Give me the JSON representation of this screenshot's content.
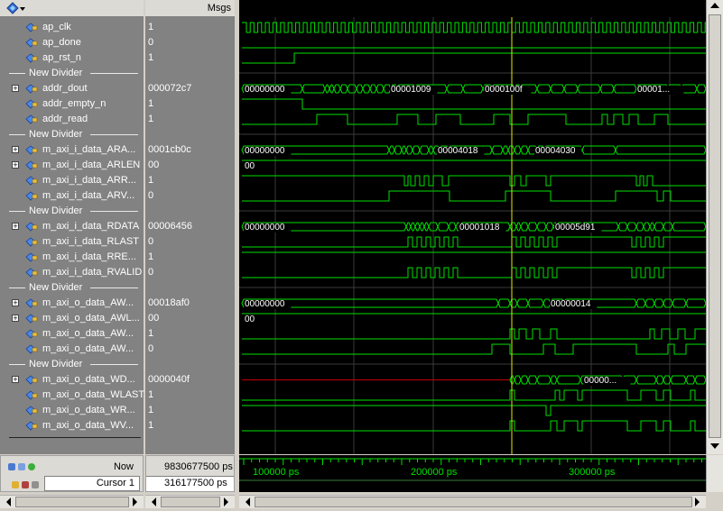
{
  "header": {
    "msgs_label": "Msgs"
  },
  "signals": [
    {
      "type": "sig",
      "name": "ap_clk",
      "value": "1"
    },
    {
      "type": "sig",
      "name": "ap_done",
      "value": "0"
    },
    {
      "type": "sig",
      "name": "ap_rst_n",
      "value": "1"
    },
    {
      "type": "div",
      "name": "New Divider"
    },
    {
      "type": "sig",
      "name": "addr_dout",
      "value": "000072c7",
      "expand": true
    },
    {
      "type": "sig",
      "name": "addr_empty_n",
      "value": "1"
    },
    {
      "type": "sig",
      "name": "addr_read",
      "value": "1"
    },
    {
      "type": "div",
      "name": "New Divider"
    },
    {
      "type": "sig",
      "name": "m_axi_i_data_ARA...",
      "value": "0001cb0c",
      "expand": true
    },
    {
      "type": "sig",
      "name": "m_axi_i_data_ARLEN",
      "value": "00",
      "expand": true
    },
    {
      "type": "sig",
      "name": "m_axi_i_data_ARR...",
      "value": "1"
    },
    {
      "type": "sig",
      "name": "m_axi_i_data_ARV...",
      "value": "0"
    },
    {
      "type": "div",
      "name": "New Divider"
    },
    {
      "type": "sig",
      "name": "m_axi_i_data_RDATA",
      "value": "00006456",
      "expand": true
    },
    {
      "type": "sig",
      "name": "m_axi_i_data_RLAST",
      "value": "0"
    },
    {
      "type": "sig",
      "name": "m_axi_i_data_RRE...",
      "value": "1"
    },
    {
      "type": "sig",
      "name": "m_axi_i_data_RVALID",
      "value": "0"
    },
    {
      "type": "div",
      "name": "New Divider"
    },
    {
      "type": "sig",
      "name": "m_axi_o_data_AW...",
      "value": "00018af0",
      "expand": true
    },
    {
      "type": "sig",
      "name": "m_axi_o_data_AWL...",
      "value": "00",
      "expand": true
    },
    {
      "type": "sig",
      "name": "m_axi_o_data_AW...",
      "value": "1"
    },
    {
      "type": "sig",
      "name": "m_axi_o_data_AW...",
      "value": "0"
    },
    {
      "type": "div",
      "name": "New Divider"
    },
    {
      "type": "sig",
      "name": "m_axi_o_data_WD...",
      "value": "0000040f",
      "expand": true
    },
    {
      "type": "sig",
      "name": "m_axi_o_data_WLAST",
      "value": "1"
    },
    {
      "type": "sig",
      "name": "m_axi_o_data_WR...",
      "value": "1"
    },
    {
      "type": "sig",
      "name": "m_axi_o_data_WV...",
      "value": "1"
    }
  ],
  "bus_labels": [
    {
      "row": 4,
      "labels": [
        "00000000",
        "00001009",
        "0000100f",
        "00001..."
      ]
    },
    {
      "row": 8,
      "labels": [
        "00000000",
        "00004018",
        "00004030"
      ]
    },
    {
      "row": 9,
      "labels": [
        "00"
      ]
    },
    {
      "row": 13,
      "labels": [
        "00000000",
        "00001018",
        "00005d91"
      ]
    },
    {
      "row": 18,
      "labels": [
        "00000000",
        "00000014"
      ]
    },
    {
      "row": 19,
      "labels": [
        "00"
      ]
    },
    {
      "row": 23,
      "labels": [
        "00000..."
      ]
    }
  ],
  "status": {
    "now_label": "Now",
    "now_value": "9830677500 ps",
    "cursor_label": "Cursor 1",
    "cursor_value": "316177500 ps",
    "time_marks": [
      "100000 ps",
      "200000 ps",
      "300000 ps"
    ]
  },
  "colors": {
    "wave": "#00e000",
    "pane": "#828282",
    "cursor": "#e8e800",
    "xstate": "#c00000"
  }
}
